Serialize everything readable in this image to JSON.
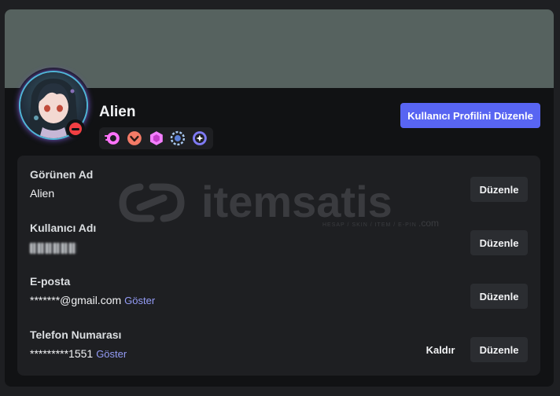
{
  "profile": {
    "display_name": "Alien",
    "edit_profile_label": "Kullanıcı Profilini Düzenle",
    "badges": [
      "nitro-icon",
      "boost-level-icon",
      "hypesquad-icon",
      "boost-gem-icon",
      "quest-icon"
    ]
  },
  "colors": {
    "banner": "#56625f",
    "accent": "#5865f2",
    "status_dnd": "#f23f43",
    "link": "#949cf7"
  },
  "watermark": {
    "brand": "itemsatis",
    "tagline": "HESAP / SKIN / ITEM / E-PIN",
    "domain": ".com"
  },
  "fields": [
    {
      "label": "Görünen Ad",
      "value": "Alien",
      "edit_label": "Düzenle"
    },
    {
      "label": "Kullanıcı Adı",
      "value": "",
      "edit_label": "Düzenle"
    },
    {
      "label": "E-posta",
      "value": "*******@gmail.com",
      "reveal_label": "Göster",
      "edit_label": "Düzenle"
    },
    {
      "label": "Telefon Numarası",
      "value": "*********1551",
      "reveal_label": "Göster",
      "remove_label": "Kaldır",
      "edit_label": "Düzenle"
    }
  ]
}
